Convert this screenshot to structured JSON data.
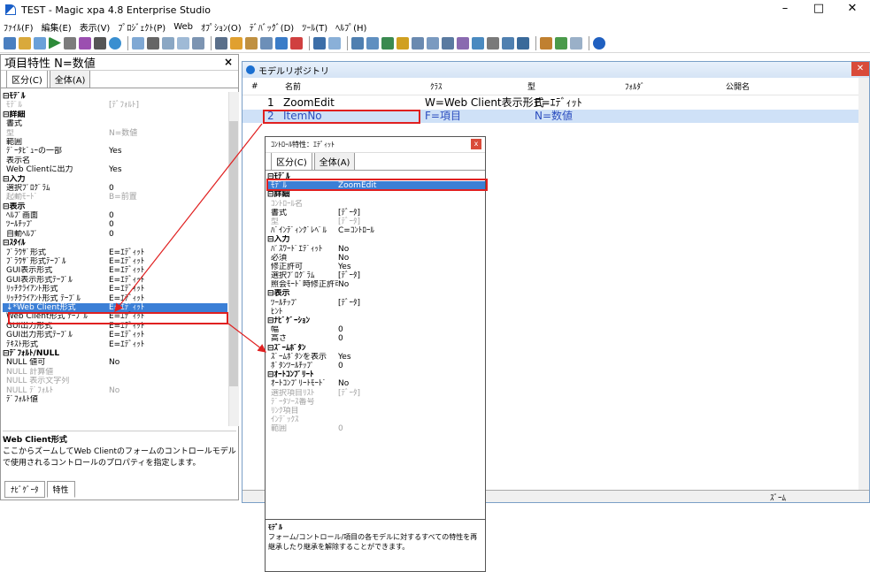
{
  "window": {
    "title": "TEST - Magic xpa 4.8 Enterprise Studio",
    "minimize": "–",
    "maximize": "□",
    "close": "✕"
  },
  "menu": [
    "ﾌｧｲﾙ(F)",
    "編集(E)",
    "表示(V)",
    "ﾌﾟﾛｼﾞｪｸﾄ(P)",
    "Web",
    "ｵﾌﾟｼｮﾝ(O)",
    "ﾃﾞﾊﾞｯｸﾞ(D)",
    "ﾂｰﾙ(T)",
    "ﾍﾙﾌﾟ(H)"
  ],
  "left_panel": {
    "title": "項目特性 N=数値",
    "close": "×",
    "tabs": [
      "区分(C)",
      "全体(A)"
    ],
    "rows": [
      {
        "k": "⊟ﾓﾃﾞﾙ",
        "v": "",
        "t": "sec"
      },
      {
        "k": "ﾓﾃﾞﾙ",
        "v": "[ﾃﾞﾌｫﾙﾄ]",
        "t": "dis"
      },
      {
        "k": "⊟詳細",
        "v": "",
        "t": "sec"
      },
      {
        "k": "書式",
        "v": "",
        "t": ""
      },
      {
        "k": "型",
        "v": "N=数値",
        "t": "dis"
      },
      {
        "k": "範囲",
        "v": "",
        "t": ""
      },
      {
        "k": "ﾃﾞｰﾀﾋﾞｭｰの一部",
        "v": "Yes",
        "t": ""
      },
      {
        "k": "表示名",
        "v": "",
        "t": ""
      },
      {
        "k": "Web Clientに出力",
        "v": "Yes",
        "t": ""
      },
      {
        "k": "⊟入力",
        "v": "",
        "t": "sec"
      },
      {
        "k": "選択ﾌﾟﾛｸﾞﾗﾑ",
        "v": "0",
        "t": ""
      },
      {
        "k": "起動ﾓｰﾄﾞ",
        "v": "B=前置",
        "t": "dis"
      },
      {
        "k": "⊟表示",
        "v": "",
        "t": "sec"
      },
      {
        "k": "ﾍﾙﾌﾟ画面",
        "v": "0",
        "t": ""
      },
      {
        "k": "ﾂｰﾙﾁｯﾌﾟ",
        "v": "0",
        "t": ""
      },
      {
        "k": "自動ﾍﾙﾌﾟ",
        "v": "0",
        "t": ""
      },
      {
        "k": "⊟ｽﾀｲﾙ",
        "v": "",
        "t": "sec"
      },
      {
        "k": "ﾌﾞﾗｳｻﾞ形式",
        "v": "E=ｴﾃﾞｨｯﾄ",
        "t": ""
      },
      {
        "k": "ﾌﾞﾗｳｻﾞ形式ﾃｰﾌﾞﾙ",
        "v": "E=ｴﾃﾞｨｯﾄ",
        "t": ""
      },
      {
        "k": "GUI表示形式",
        "v": "E=ｴﾃﾞｨｯﾄ",
        "t": ""
      },
      {
        "k": "GUI表示形式ﾃｰﾌﾞﾙ",
        "v": "E=ｴﾃﾞｨｯﾄ",
        "t": ""
      },
      {
        "k": "ﾘｯﾁｸﾗｲｱﾝﾄ形式",
        "v": "E=ｴﾃﾞｨｯﾄ",
        "t": ""
      },
      {
        "k": "ﾘｯﾁｸﾗｲｱﾝﾄ形式 ﾃｰﾌﾞﾙ",
        "v": "E=ｴﾃﾞｨｯﾄ",
        "t": ""
      },
      {
        "k": "↓*Web Client形式",
        "v": "E=ｴﾃﾞｨｯﾄ",
        "t": "sel"
      },
      {
        "k": "Web Client形式 ﾃｰﾌﾞﾙ",
        "v": "E=ｴﾃﾞｨｯﾄ",
        "t": ""
      },
      {
        "k": "GUI出力形式",
        "v": "E=ｴﾃﾞｨｯﾄ",
        "t": ""
      },
      {
        "k": "GUI出力形式ﾃｰﾌﾞﾙ",
        "v": "E=ｴﾃﾞｨｯﾄ",
        "t": ""
      },
      {
        "k": "ﾃｷｽﾄ形式",
        "v": "E=ｴﾃﾞｨｯﾄ",
        "t": ""
      },
      {
        "k": "⊟ﾃﾞﾌｫﾙﾄ/NULL",
        "v": "",
        "t": "sec"
      },
      {
        "k": "NULL 値可",
        "v": "No",
        "t": ""
      },
      {
        "k": "NULL 計算値",
        "v": "",
        "t": "dis"
      },
      {
        "k": "NULL 表示文字列",
        "v": "",
        "t": "dis"
      },
      {
        "k": "NULL ﾃﾞﾌｫﾙﾄ",
        "v": "No",
        "t": "dis"
      },
      {
        "k": "ﾃﾞﾌｫﾙﾄ値",
        "v": "",
        "t": ""
      }
    ],
    "desc_title": "Web Client形式",
    "desc_text": "ここからズームしてWeb Clientのフォームのコントロールモデルで使用されるコントロールのプロパティを指定します。",
    "bottom_tabs": [
      "ﾅﾋﾞｹﾞｰﾀ",
      "特性"
    ]
  },
  "repository": {
    "title": "モデルリポジトリ",
    "close": "✕",
    "columns": [
      "#",
      "名前",
      "ｸﾗｽ",
      "型",
      "ﾌｫﾙﾀﾞ",
      "公開名"
    ],
    "rows": [
      {
        "num": "1",
        "name": "ZoomEdit",
        "cls": "W=Web Client表示形式",
        "type": "E=ｴﾃﾞｨｯﾄ"
      },
      {
        "num": "2",
        "name": "ItemNo",
        "cls": "F=項目",
        "type": "N=数値"
      }
    ],
    "status": "ｽﾞｰﾑ"
  },
  "control_dialog": {
    "title": "ｺﾝﾄﾛｰﾙ特性：ｴﾃﾞｨｯﾄ",
    "close": "x",
    "tabs": [
      "区分(C)",
      "全体(A)"
    ],
    "rows": [
      {
        "k": "⊟ﾓﾃﾞﾙ",
        "v": "",
        "t": "sec"
      },
      {
        "k": "ﾓﾃﾞﾙ",
        "v": "ZoomEdit",
        "t": "sel"
      },
      {
        "k": "⊟詳細",
        "v": "",
        "t": "sec"
      },
      {
        "k": "ｺﾝﾄﾛｰﾙ名",
        "v": "",
        "t": "dis"
      },
      {
        "k": "書式",
        "v": "[ﾃﾞｰﾀ]",
        "t": ""
      },
      {
        "k": "型",
        "v": "[ﾃﾞｰﾀ]",
        "t": "dis"
      },
      {
        "k": "ﾊﾞｲﾝﾃﾞｨﾝｸﾞﾚﾍﾞﾙ",
        "v": "C=ｺﾝﾄﾛｰﾙ",
        "t": ""
      },
      {
        "k": "⊟入力",
        "v": "",
        "t": "sec"
      },
      {
        "k": "ﾊﾟｽﾜｰﾄﾞｴﾃﾞｨｯﾄ",
        "v": "No",
        "t": ""
      },
      {
        "k": "必須",
        "v": "No",
        "t": ""
      },
      {
        "k": "修正許可",
        "v": "Yes",
        "t": ""
      },
      {
        "k": "選択ﾌﾟﾛｸﾞﾗﾑ",
        "v": "[ﾃﾞｰﾀ]",
        "t": ""
      },
      {
        "k": "照会ﾓｰﾄﾞ時修正許可",
        "v": "No",
        "t": ""
      },
      {
        "k": "⊟表示",
        "v": "",
        "t": "sec"
      },
      {
        "k": "ﾂｰﾙﾁｯﾌﾟ",
        "v": "[ﾃﾞｰﾀ]",
        "t": ""
      },
      {
        "k": "ﾋﾝﾄ",
        "v": "",
        "t": ""
      },
      {
        "k": "⊟ﾅﾋﾞｹﾞｰｼｮﾝ",
        "v": "",
        "t": "sec"
      },
      {
        "k": "幅",
        "v": "0",
        "t": ""
      },
      {
        "k": "高さ",
        "v": "0",
        "t": ""
      },
      {
        "k": "⊟ｽﾞｰﾑﾎﾞﾀﾝ",
        "v": "",
        "t": "sec"
      },
      {
        "k": "ｽﾞｰﾑﾎﾞﾀﾝを表示",
        "v": "Yes",
        "t": ""
      },
      {
        "k": "ﾎﾞﾀﾝﾂｰﾙﾁｯﾌﾟ",
        "v": "0",
        "t": ""
      },
      {
        "k": "⊟ｵｰﾄｺﾝﾌﾟﾘｰﾄ",
        "v": "",
        "t": "sec"
      },
      {
        "k": "ｵｰﾄｺﾝﾌﾟﾘｰﾄﾓｰﾄﾞ",
        "v": "No",
        "t": ""
      },
      {
        "k": "選択項目ﾘｽﾄ",
        "v": "[ﾃﾞｰﾀ]",
        "t": "dis"
      },
      {
        "k": "ﾃﾞｰﾀｿｰｽ番号",
        "v": "",
        "t": "dis"
      },
      {
        "k": "ﾘﾝｸ項目",
        "v": "",
        "t": "dis"
      },
      {
        "k": "ｲﾝﾃﾞｯｸｽ",
        "v": "",
        "t": "dis"
      },
      {
        "k": "範囲",
        "v": "0",
        "t": "dis"
      }
    ],
    "desc_title": "ﾓﾃﾞﾙ",
    "desc_text": "フォーム/コントロール/項目の各モデルに対するすべての特性を再継承したり継承を解除することができます。"
  }
}
